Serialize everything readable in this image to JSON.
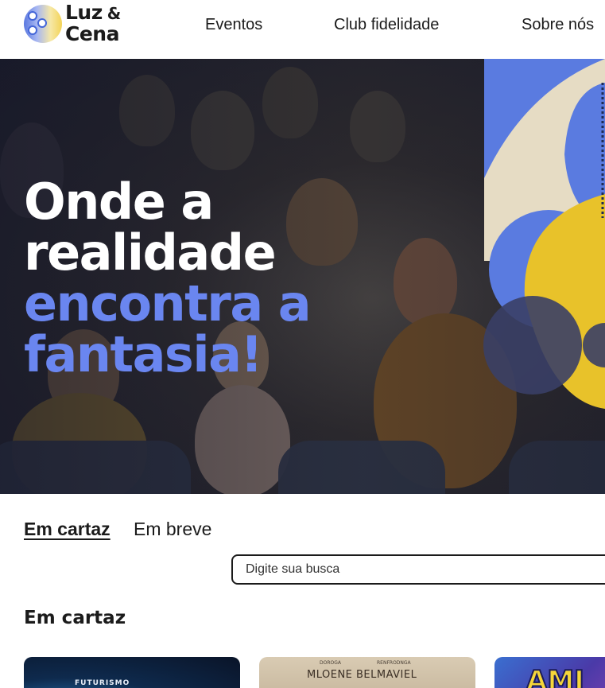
{
  "brand": {
    "line1": "Luz",
    "amp": "&",
    "line2": "Cena"
  },
  "nav": {
    "items": [
      "Eventos",
      "Club fidelidade",
      "Sobre nós"
    ]
  },
  "hero": {
    "line1": "Onde a",
    "line2": "realidade",
    "line3": "encontra a",
    "line4": "fantasia!",
    "colors": {
      "white_text": "#ffffff",
      "accent_text": "#6a86f0",
      "shape_blue": "#5a7be0",
      "shape_cream": "#e6dcc4",
      "shape_yellow": "#e8c22a"
    }
  },
  "tabs": {
    "items": [
      "Em cartaz",
      "Em breve"
    ],
    "active": "Em cartaz"
  },
  "search": {
    "placeholder": "Digite sua busca"
  },
  "section": {
    "title": "Em cartaz"
  },
  "posters": {
    "p1": {
      "text": "FUTURISMO"
    },
    "p2": {
      "small_left": "DOROGA",
      "small_right": "RENFRODNGA",
      "title": "MLOENE BELMAVIEL"
    },
    "p3": {
      "text": "AMI"
    }
  }
}
